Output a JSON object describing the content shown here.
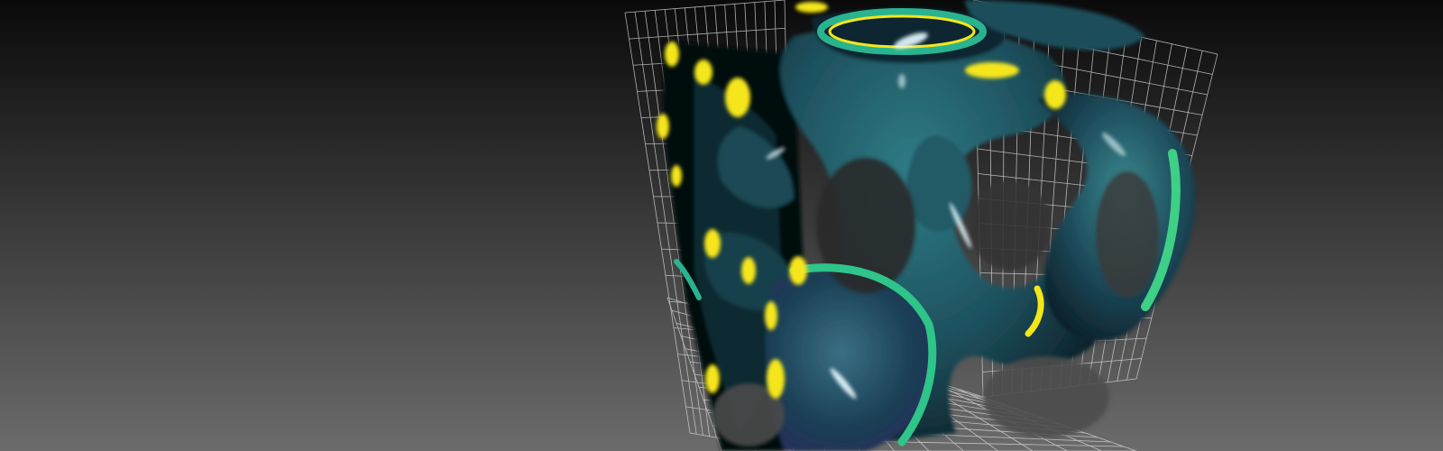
{
  "scene": {
    "background_top": "#0a0a0a",
    "background_bottom": "#6b6b6b",
    "grid_color": "#d8d8d8",
    "surface_palette": {
      "dark": "#0b1f2a",
      "teal": "#1f5a66",
      "cyan": "#2aa6a0",
      "green": "#3fc88a",
      "yellow": "#f5e61a",
      "purple": "#3a2d6b",
      "highlight": "#e8fbff"
    }
  }
}
